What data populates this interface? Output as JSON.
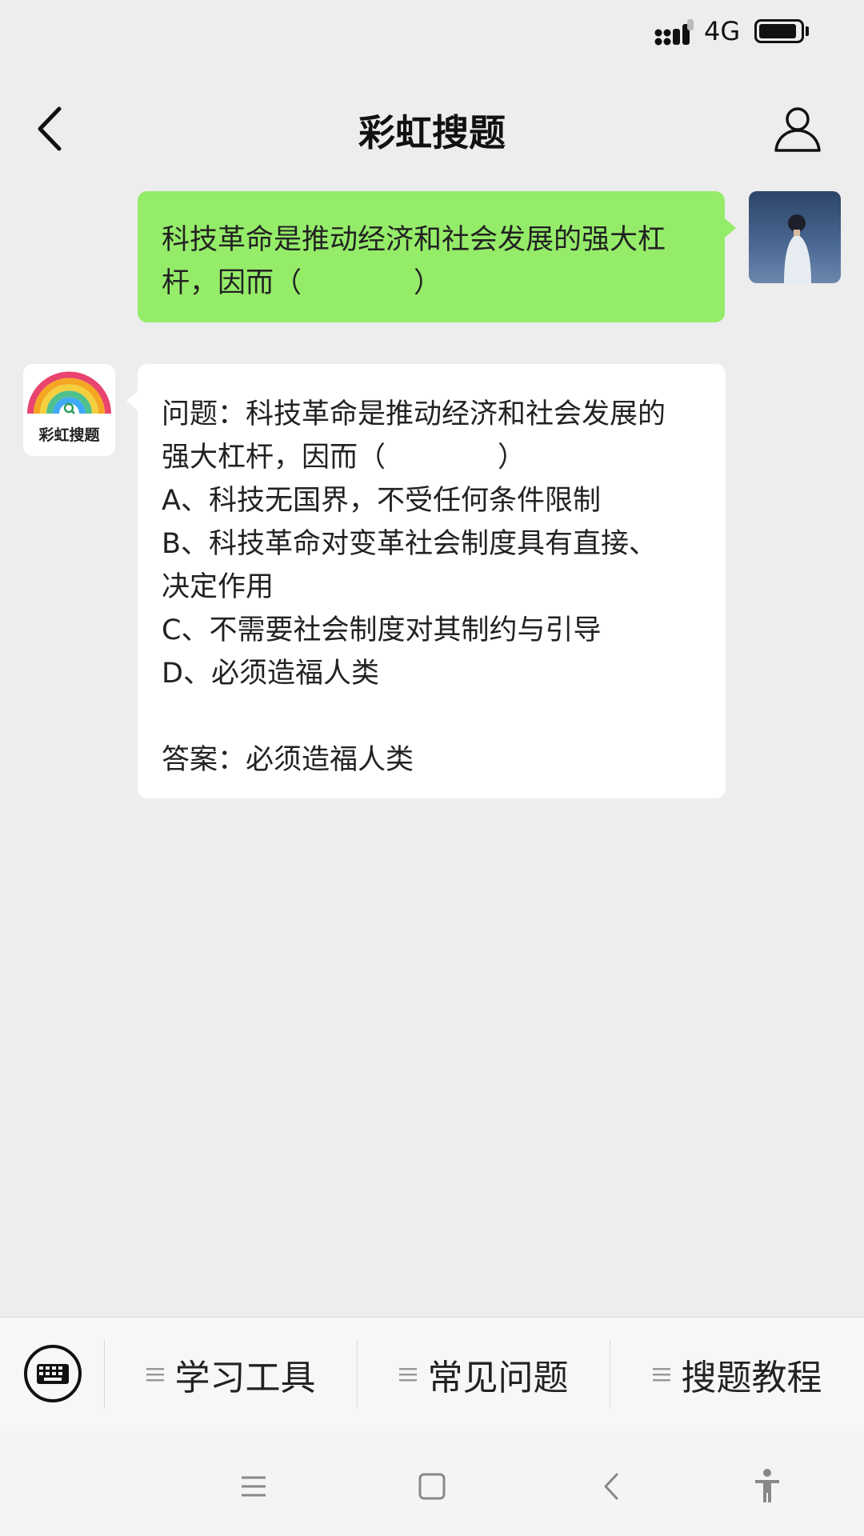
{
  "status_bar": {
    "network": "4G",
    "battery_level": 0.92
  },
  "nav": {
    "title": "彩虹搜题"
  },
  "messages": {
    "user_question": [
      "科技革命是推动经济和社会发展的强大杠",
      "杆，因而（　　　　）"
    ],
    "bot_avatar_label": "彩虹搜题",
    "bot_reply": {
      "lines": [
        "问题：科技革命是推动经济和社会发展的",
        "强大杠杆，因而（　　　　）",
        "A、科技无国界，不受任何条件限制",
        "B、科技革命对变革社会制度具有直接、",
        "决定作用",
        "C、不需要社会制度对其制约与引导",
        "D、必须造福人类"
      ],
      "answer": "答案：必须造福人类"
    }
  },
  "menu": {
    "items": [
      {
        "label": "学习工具"
      },
      {
        "label": "常见问题"
      },
      {
        "label": "搜题教程"
      }
    ]
  },
  "colors": {
    "background": "#ededed",
    "user_bubble": "#95ec69",
    "bot_bubble": "#ffffff"
  },
  "icons": [
    "signal-icon",
    "battery-icon",
    "back-arrow-icon",
    "profile-icon",
    "keyboard-icon",
    "menu-lines-icon",
    "recent-apps-icon",
    "home-icon",
    "system-back-icon",
    "accessibility-icon"
  ]
}
